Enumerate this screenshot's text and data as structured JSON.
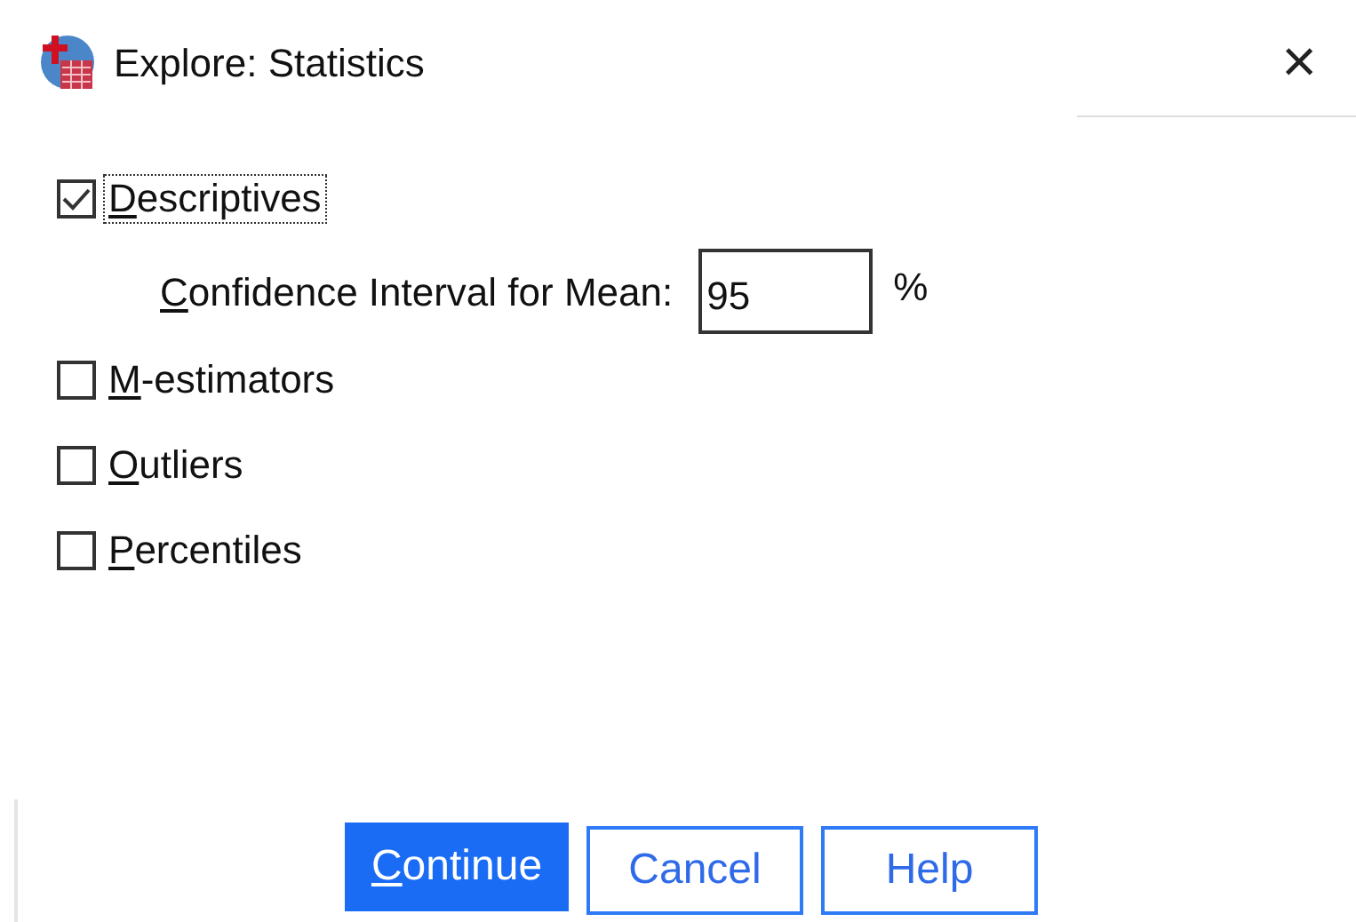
{
  "window": {
    "title": "Explore: Statistics",
    "close": "×"
  },
  "options": [
    {
      "kind": "checkbox",
      "label": "Descriptives",
      "checked": true,
      "focused": true,
      "mnemonic": true
    },
    {
      "kind": "field",
      "label": "Confidence Interval for Mean:",
      "value": "95",
      "unit": "%",
      "mnemonic": true
    },
    {
      "kind": "checkbox",
      "label": "M-estimators",
      "checked": false,
      "focused": false,
      "mnemonic": true
    },
    {
      "kind": "checkbox",
      "label": "Outliers",
      "checked": false,
      "focused": false,
      "mnemonic": true
    },
    {
      "kind": "checkbox",
      "label": "Percentiles",
      "checked": false,
      "focused": false,
      "mnemonic": true
    }
  ],
  "buttons": [
    {
      "label": "Continue",
      "default": true,
      "mnemonic": true
    },
    {
      "label": "Cancel",
      "default": false,
      "mnemonic": false
    },
    {
      "label": "Help",
      "default": false,
      "mnemonic": false
    }
  ]
}
